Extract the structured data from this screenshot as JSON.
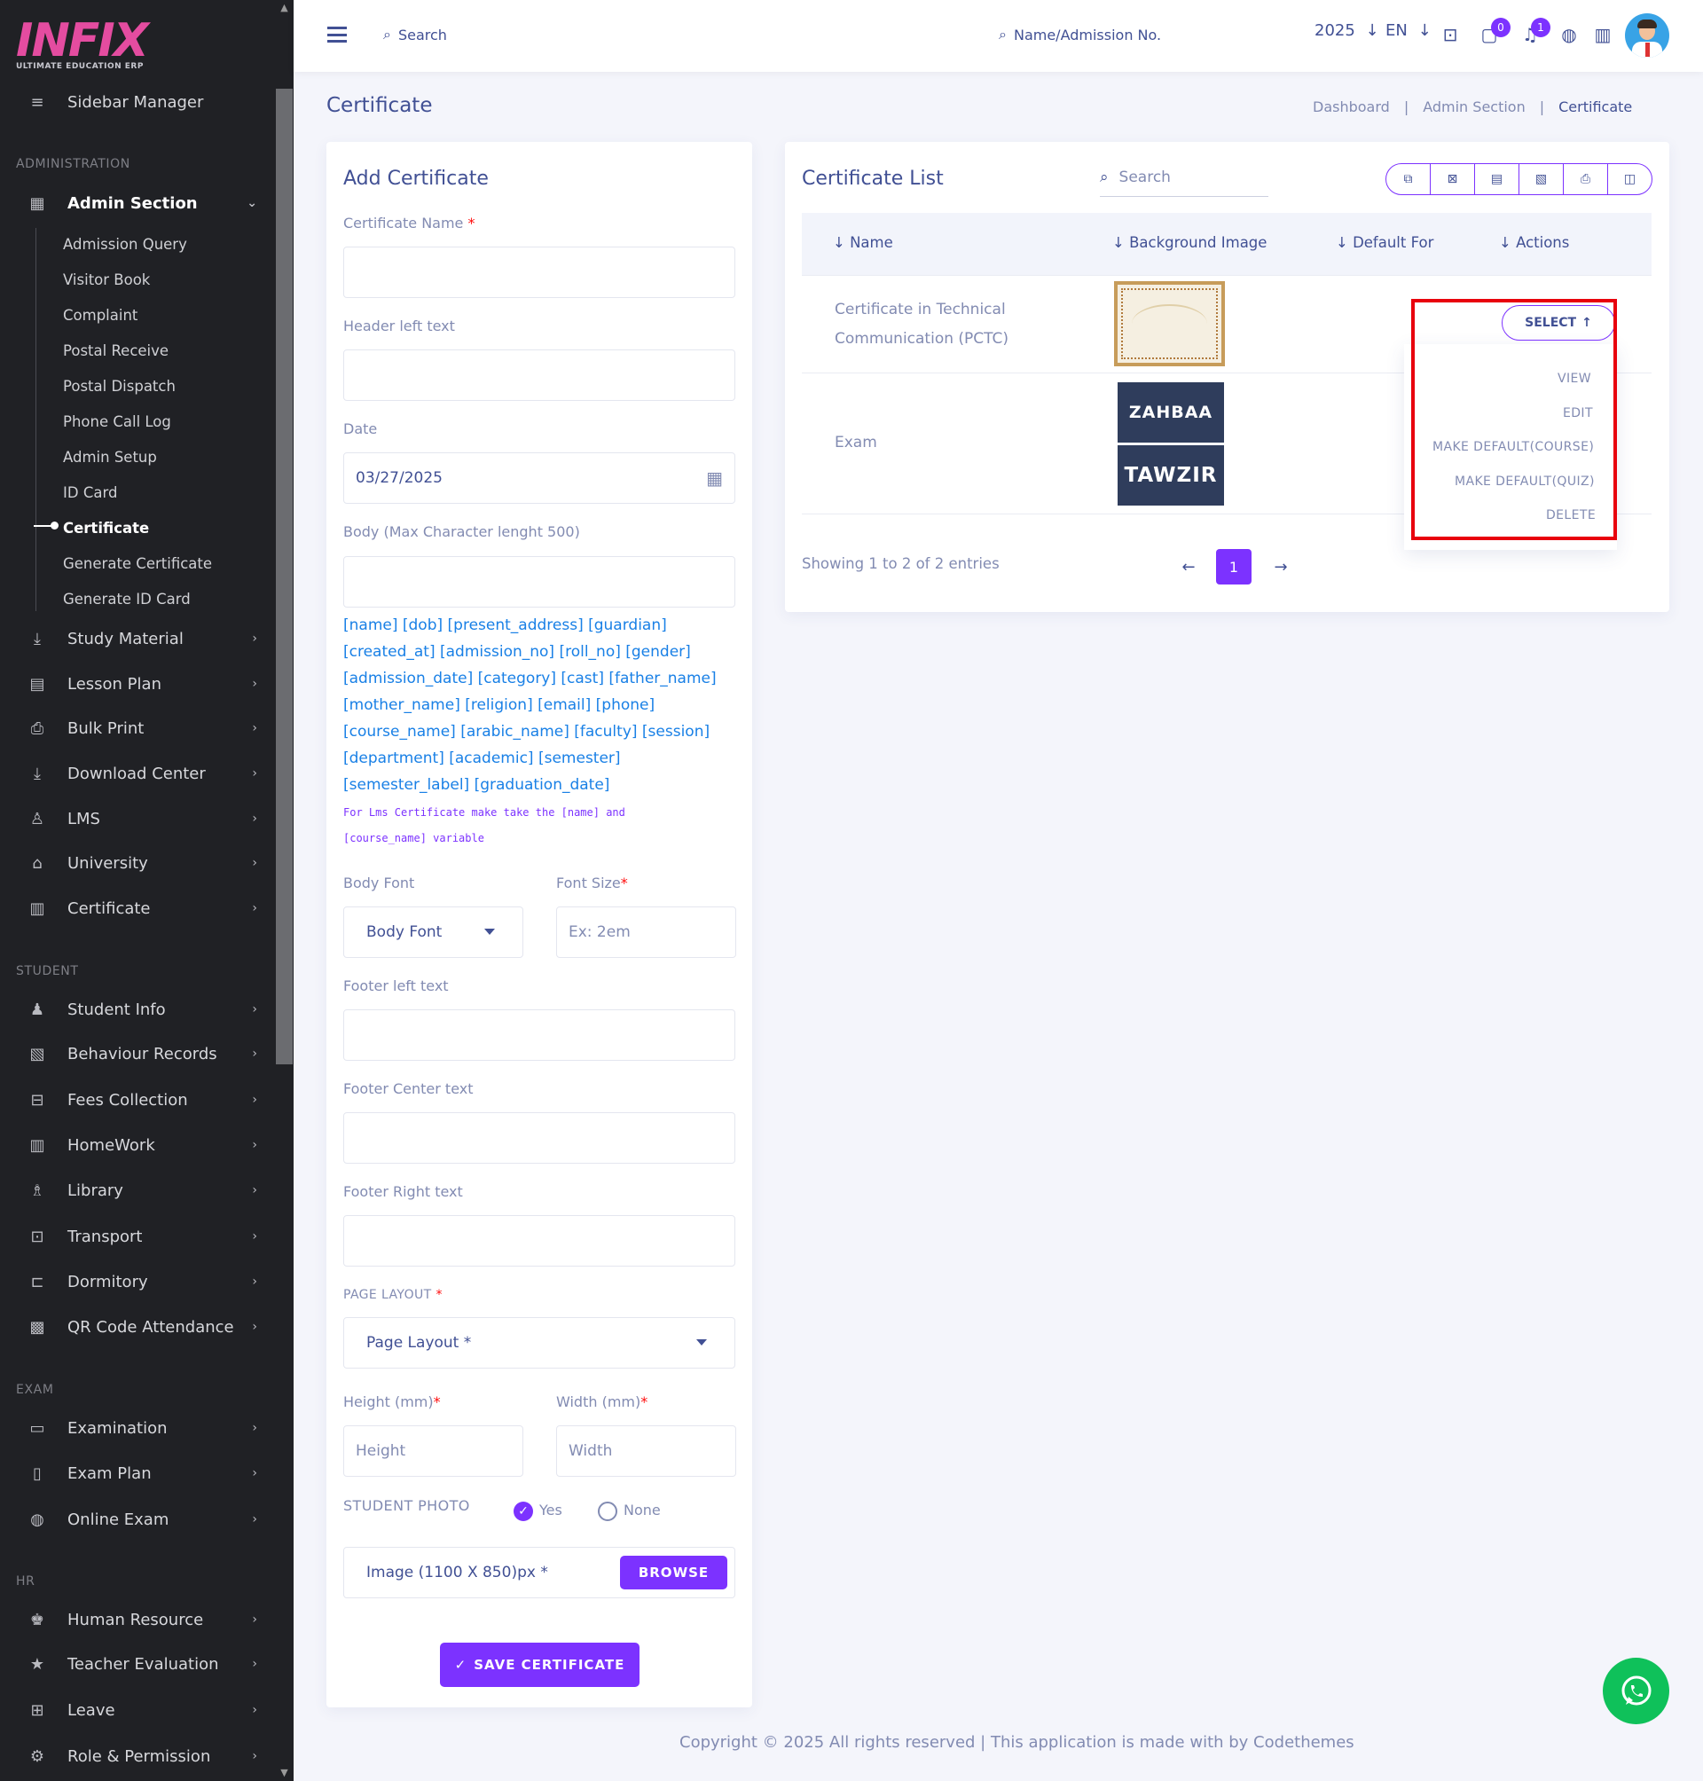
{
  "logo": {
    "text": "INFIX",
    "subtitle": "ULTIMATE EDUCATION ERP"
  },
  "sidebar": {
    "manager": "Sidebar Manager",
    "sections": {
      "administration": "ADMINISTRATION",
      "student": "STUDENT",
      "exam": "EXAM",
      "hr": "HR"
    },
    "admin_section": "Admin Section",
    "admin_sub": [
      "Admission Query",
      "Visitor Book",
      "Complaint",
      "Postal Receive",
      "Postal Dispatch",
      "Phone Call Log",
      "Admin Setup",
      "ID Card",
      "Certificate",
      "Generate Certificate",
      "Generate ID Card"
    ],
    "admin_items": [
      "Study Material",
      "Lesson Plan",
      "Bulk Print",
      "Download Center",
      "LMS",
      "University",
      "Certificate"
    ],
    "student_items": [
      "Student Info",
      "Behaviour Records",
      "Fees Collection",
      "HomeWork",
      "Library",
      "Transport",
      "Dormitory",
      "QR Code Attendance"
    ],
    "exam_items": [
      "Examination",
      "Exam Plan",
      "Online Exam"
    ],
    "hr_items": [
      "Human Resource",
      "Teacher Evaluation",
      "Leave",
      "Role & Permission"
    ]
  },
  "topbar": {
    "search": "Search",
    "student_search": "Name/Admission No.",
    "year": "2025",
    "lang": "EN",
    "chat_count": "0",
    "notif_count": "1"
  },
  "page": {
    "title": "Certificate",
    "breadcrumb": [
      "Dashboard",
      "Admin Section",
      "Certificate"
    ]
  },
  "form": {
    "title": "Add Certificate",
    "certificate_name": "Certificate Name",
    "header_left": "Header left text",
    "date_label": "Date",
    "date_value": "03/27/2025",
    "body_label": "Body (Max Character lenght 500)",
    "tags": "[name] [dob] [present_address] [guardian] [created_at] [admission_no] [roll_no] [gender] [admission_date] [category] [cast] [father_name] [mother_name] [religion] [email] [phone] [course_name] [arabic_name] [faculty] [session] [department] [academic] [semester] [semester_label] [graduation_date]",
    "lms_note": "For Lms Certificate make take the [name] and [course_name] variable",
    "body_font_label": "Body Font",
    "body_font_value": "Body Font",
    "font_size_label": "Font Size",
    "font_size_placeholder": "Ex: 2em",
    "footer_left": "Footer left text",
    "footer_center": "Footer Center text",
    "footer_right": "Footer Right text",
    "page_layout_label": "PAGE LAYOUT",
    "page_layout_value": "Page Layout *",
    "height_label": "Height (mm)",
    "height_placeholder": "Height",
    "width_label": "Width (mm)",
    "width_placeholder": "Width",
    "student_photo": "STUDENT PHOTO",
    "yes": "Yes",
    "none": "None",
    "image_label": "Image (1100 X 850)px *",
    "browse": "BROWSE",
    "save": "SAVE CERTIFICATE"
  },
  "list": {
    "title": "Certificate List",
    "search_placeholder": "Search",
    "columns": [
      "Name",
      "Background Image",
      "Default For",
      "Actions"
    ],
    "rows": [
      {
        "name": "Certificate in Technical Communication (PCTC)"
      },
      {
        "name": "Exam",
        "thumb_top": "ZAHBAA",
        "thumb_bottom": "TAWZIR"
      }
    ],
    "select": "SELECT",
    "menu": [
      "VIEW",
      "EDIT",
      "MAKE DEFAULT(COURSE)",
      "MAKE DEFAULT(QUIZ)",
      "DELETE"
    ],
    "showing": "Showing 1 to 2 of 2 entries",
    "page": "1"
  },
  "footer": "Copyright © 2025 All rights reserved | This application is made with by Codethemes",
  "colors": {
    "accent": "#7c32ff",
    "text": "#415094",
    "muted": "#828bb2",
    "sidebar": "#202125",
    "highlight": "#e8000d"
  }
}
